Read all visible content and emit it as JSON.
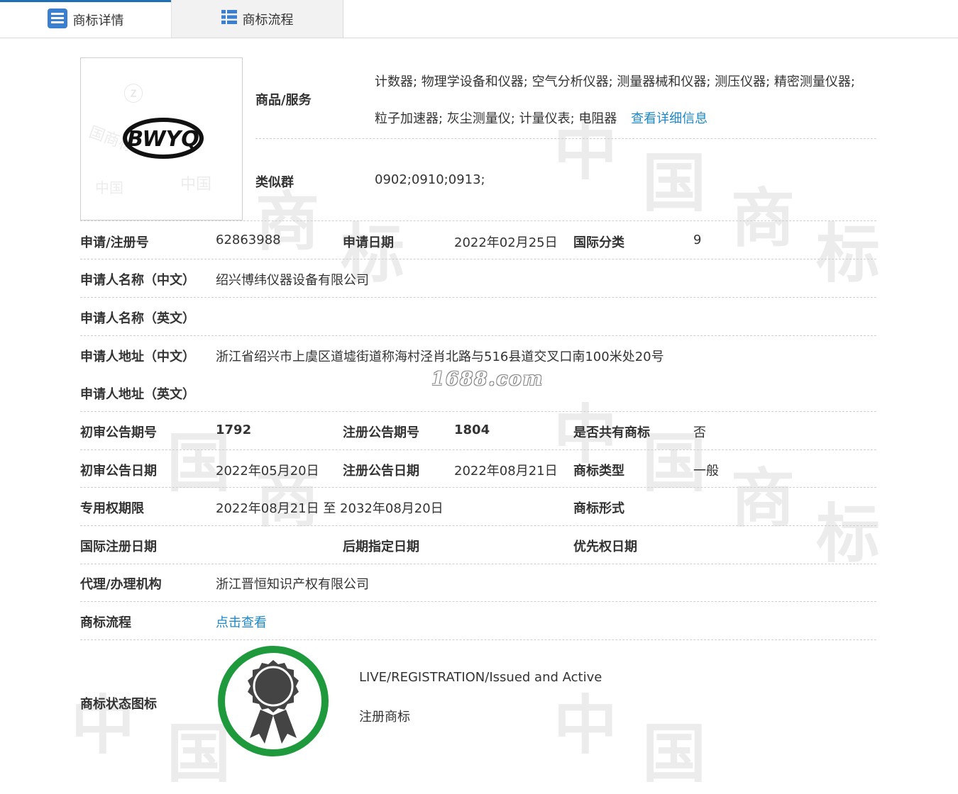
{
  "tabs": [
    {
      "label": "商标详情",
      "active": true
    },
    {
      "label": "商标流程",
      "active": false
    }
  ],
  "logo": {
    "text": "BWYQ"
  },
  "goods": {
    "label": "商品/服务",
    "line1": "计数器; 物理学设备和仪器; 空气分析仪器; 测量器械和仪器; 测压仪器; 精密测量仪器;",
    "line2": "粒子加速器; 灰尘测量仪; 计量仪表; 电阻器",
    "detail_link": "查看详细信息"
  },
  "similar": {
    "label": "类似群",
    "value": "0902;0910;0913;"
  },
  "rows": {
    "reg_no": {
      "label": "申请/注册号",
      "value": "62863988"
    },
    "apply_date": {
      "label": "申请日期",
      "value": "2022年02月25日"
    },
    "intl_class": {
      "label": "国际分类",
      "value": "9"
    },
    "applicant_cn": {
      "label": "申请人名称（中文）",
      "value": "绍兴博纬仪器设备有限公司"
    },
    "applicant_en": {
      "label": "申请人名称（英文）",
      "value": ""
    },
    "address_cn": {
      "label": "申请人地址（中文）",
      "value": "浙江省绍兴市上虞区道墟街道称海村泾肖北路与516县道交叉口南100米处20号"
    },
    "address_en": {
      "label": "申请人地址（英文）",
      "value": ""
    },
    "prelim_no": {
      "label": "初审公告期号",
      "value": "1792"
    },
    "reg_ann_no": {
      "label": "注册公告期号",
      "value": "1804"
    },
    "shared": {
      "label": "是否共有商标",
      "value": "否"
    },
    "prelim_date": {
      "label": "初审公告日期",
      "value": "2022年05月20日"
    },
    "reg_ann_date": {
      "label": "注册公告日期",
      "value": "2022年08月21日"
    },
    "tm_type": {
      "label": "商标类型",
      "value": "一般"
    },
    "exclusive": {
      "label": "专用权期限",
      "value": "2022年08月21日 至 2032年08月20日"
    },
    "tm_form": {
      "label": "商标形式",
      "value": ""
    },
    "intl_reg_date": {
      "label": "国际注册日期",
      "value": ""
    },
    "later_date": {
      "label": "后期指定日期",
      "value": ""
    },
    "priority_date": {
      "label": "优先权日期",
      "value": ""
    },
    "agent": {
      "label": "代理/办理机构",
      "value": "浙江晋恒知识产权有限公司"
    },
    "flow": {
      "label": "商标流程",
      "link": "点击查看"
    },
    "status": {
      "label": "商标状态图标",
      "line1": "LIVE/REGISTRATION/Issued and Active",
      "line2": "注册商标"
    }
  },
  "watermark": "1688.com",
  "colors": {
    "link": "#1e88c7",
    "tab_accent": "#1f6fb7",
    "badge_ring": "#1e9a3c",
    "badge_seal": "#444444"
  }
}
